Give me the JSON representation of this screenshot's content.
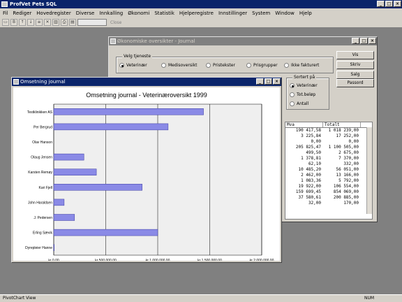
{
  "app": {
    "title": "ProfVet Pets SQL"
  },
  "menu": [
    "Fil",
    "Rediger",
    "Hovedregister",
    "Diverse",
    "Innkalling",
    "Økonomi",
    "Statistik",
    "Hjelperegistre",
    "Innstillinger",
    "System",
    "Window",
    "Hjelp"
  ],
  "toolbar": {
    "close_label": "Close"
  },
  "status": {
    "left": "PivotChart View",
    "num": "NUM"
  },
  "oversikt": {
    "title": "Økonomiske oversikter - Journal",
    "group_title": "Velg tjeneste",
    "options": [
      "Veterinær",
      "Medisoversikt",
      "Pristekster",
      "Prisgrupper",
      "Ikke fakturert"
    ],
    "sort_title": "Sortert på",
    "sort_options": [
      "Veterinær",
      "Tot.beløp",
      "Antall"
    ],
    "buttons": [
      "Vis",
      "Skriv",
      "Salg",
      "Passord"
    ],
    "grid_headers": [
      "Mva",
      "Totalt"
    ],
    "grid_rows": [
      [
        "190 417,58",
        "1 018 239,00"
      ],
      [
        "3 225,84",
        "17 252,00"
      ],
      [
        "0,00",
        "0,00"
      ],
      [
        "205 825,47",
        "1 100 505,00"
      ],
      [
        "499,50",
        "2 675,00"
      ],
      [
        "1 378,81",
        "7 370,00"
      ],
      [
        "62,10",
        "332,00"
      ],
      [
        "10 485,20",
        "56 051,00"
      ],
      [
        "2 462,00",
        "13 166,00"
      ],
      [
        "1 083,36",
        "5 792,00"
      ],
      [
        "19 922,00",
        "106 554,00"
      ],
      [
        "159 699,45",
        "854 069,00"
      ],
      [
        "37 580,61",
        "200 885,00"
      ],
      [
        "32,00",
        "170,00"
      ]
    ]
  },
  "chart_window": {
    "title": "Omsetning journal"
  },
  "chart_data": {
    "type": "bar",
    "orientation": "horizontal",
    "title": "Omsetning journal - Veterinæroversikt 1999",
    "categories": [
      "Testklinikken AS",
      "Per Bergrud",
      "Olav Hanson",
      "Olaug Jensen",
      "Karsten Remøy",
      "Kari Fjell",
      "John Haraldsen",
      "J. Pedersen",
      "Erling Sævik",
      "Dyrepleier Hanne"
    ],
    "values": [
      1440000,
      1100000,
      0,
      290000,
      410000,
      850000,
      100000,
      200000,
      1000000,
      5000
    ],
    "xlim": [
      0,
      2000000
    ],
    "xticks": [
      "kr 0,00",
      "kr 500 000,00",
      "kr 1 000 000,00",
      "kr 1 500 000,00",
      "kr 2 000 000,00"
    ],
    "grid": true,
    "bar_color": "#8a8ae6"
  }
}
